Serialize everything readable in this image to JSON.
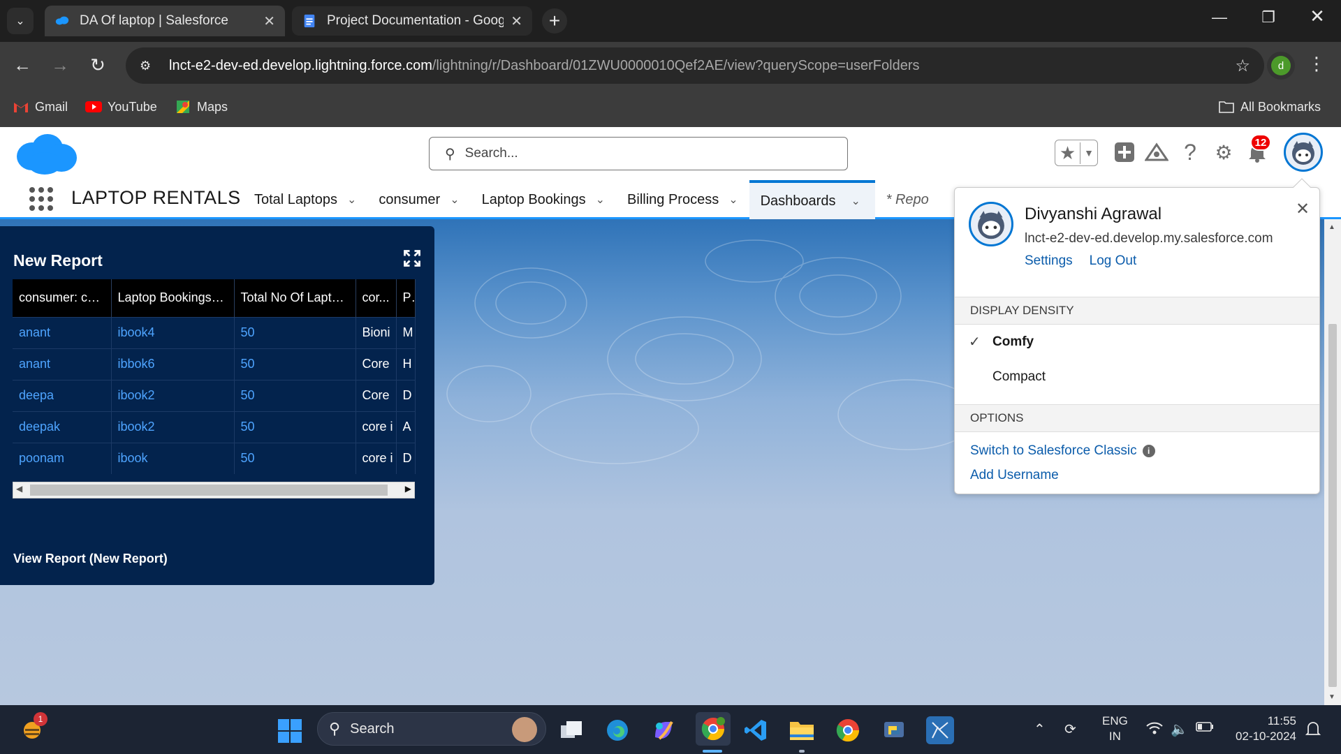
{
  "browser": {
    "tabs": [
      {
        "title": "DA Of laptop | Salesforce",
        "active": true
      },
      {
        "title": "Project Documentation - Googl",
        "active": false
      }
    ],
    "url_host": "lnct-e2-dev-ed.develop.lightning.force.com",
    "url_path": "/lightning/r/Dashboard/01ZWU0000010Qef2AE/view?queryScope=userFolders",
    "profile_initial": "d",
    "bookmarks": [
      {
        "label": "Gmail",
        "icon": "gmail-icon"
      },
      {
        "label": "YouTube",
        "icon": "youtube-icon"
      },
      {
        "label": "Maps",
        "icon": "maps-icon"
      }
    ],
    "all_bookmarks": "All Bookmarks"
  },
  "header": {
    "search_placeholder": "Search...",
    "notification_count": "12",
    "app_name": "LAPTOP RENTALS",
    "nav_tabs": [
      {
        "label": "Total Laptops",
        "has_menu": true
      },
      {
        "label": "consumer",
        "has_menu": true
      },
      {
        "label": "Laptop Bookings",
        "has_menu": true
      },
      {
        "label": "Billing Process",
        "has_menu": true
      },
      {
        "label": "Dashboards",
        "has_menu": true,
        "active": true
      },
      {
        "label": "* Repo",
        "has_menu": false
      }
    ]
  },
  "report_card": {
    "title": "New Report",
    "columns": [
      "consumer: co...",
      "Laptop Bookings: ...",
      "Total No Of Lapto...",
      "cor...",
      "Pi"
    ],
    "rows": [
      [
        "anant",
        "ibook4",
        "50",
        "Bioni",
        "M"
      ],
      [
        "anant",
        "ibbok6",
        "50",
        "Core",
        "H"
      ],
      [
        "deepa",
        "ibook2",
        "50",
        "Core",
        "D"
      ],
      [
        "deepak",
        "ibook2",
        "50",
        "core i",
        "A"
      ],
      [
        "poonam",
        "ibook",
        "50",
        "core i",
        "D"
      ]
    ],
    "footer_link": "View Report (New Report)"
  },
  "profile_popover": {
    "name": "Divyanshi Agrawal",
    "domain": "lnct-e2-dev-ed.develop.my.salesforce.com",
    "settings_link": "Settings",
    "logout_link": "Log Out",
    "density_header": "DISPLAY DENSITY",
    "density_options": [
      "Comfy",
      "Compact"
    ],
    "selected_density": "Comfy",
    "options_header": "OPTIONS",
    "switch_classic": "Switch to Salesforce Classic",
    "add_username": "Add Username"
  },
  "taskbar": {
    "widget_badge": "1",
    "search_label": "Search",
    "lang_line1": "ENG",
    "lang_line2": "IN",
    "time": "11:55",
    "date": "02-10-2024"
  },
  "colors": {
    "sf_brand": "#0176d3",
    "card_bg": "#03234d",
    "link": "#4ea4ff",
    "badge": "#e00000"
  }
}
